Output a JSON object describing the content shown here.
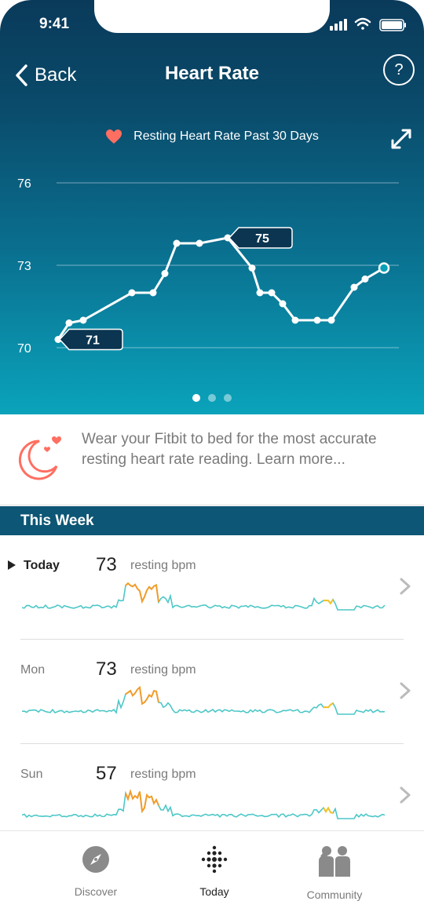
{
  "status_bar": {
    "time": "9:41"
  },
  "nav": {
    "back_label": "Back",
    "title": "Heart Rate",
    "help_label": "?"
  },
  "chart_legend": "Resting Heart Rate Past 30 Days",
  "colors": {
    "accent_heart": "#ff6f61",
    "hero_top": "#0a3a5a",
    "hero_bottom": "#0aa3bb",
    "week_bar": "#0d5675",
    "spark_line": "#4ec7c7"
  },
  "chart_data": {
    "type": "line",
    "title": "Resting Heart Rate Past 30 Days",
    "ylim": [
      70,
      76
    ],
    "y_ticks": [
      76,
      73,
      70
    ],
    "x": [
      1,
      2,
      3,
      4,
      5,
      6,
      7,
      8,
      9,
      10,
      11,
      12,
      13,
      14,
      15,
      16,
      17,
      18,
      19,
      20,
      21,
      22,
      23,
      24,
      25,
      26
    ],
    "y": [
      70.3,
      70.9,
      71.0,
      72.0,
      72.0,
      72.7,
      73.8,
      73.8,
      74.0,
      72.9,
      72.0,
      72.0,
      71.6,
      71.0,
      71.0,
      71.0,
      72.2,
      72.5,
      72.9
    ],
    "annotations": [
      {
        "label": "75",
        "point_index": 8
      },
      {
        "label": "71",
        "point_index": 0
      }
    ],
    "pagination": {
      "pages": 3,
      "active": 0
    }
  },
  "tip": {
    "text": "Wear your Fitbit to bed for the most accurate resting heart rate reading. Learn more..."
  },
  "week": {
    "title": "This Week",
    "days": [
      {
        "name": "Today",
        "value": "73",
        "unit": "resting bpm"
      },
      {
        "name": "Mon",
        "value": "73",
        "unit": "resting bpm"
      },
      {
        "name": "Sun",
        "value": "57",
        "unit": "resting bpm"
      }
    ]
  },
  "tabs": [
    {
      "label": "Discover",
      "icon": "compass-icon"
    },
    {
      "label": "Today",
      "icon": "fitbit-dots-icon"
    },
    {
      "label": "Community",
      "icon": "community-icon"
    }
  ]
}
